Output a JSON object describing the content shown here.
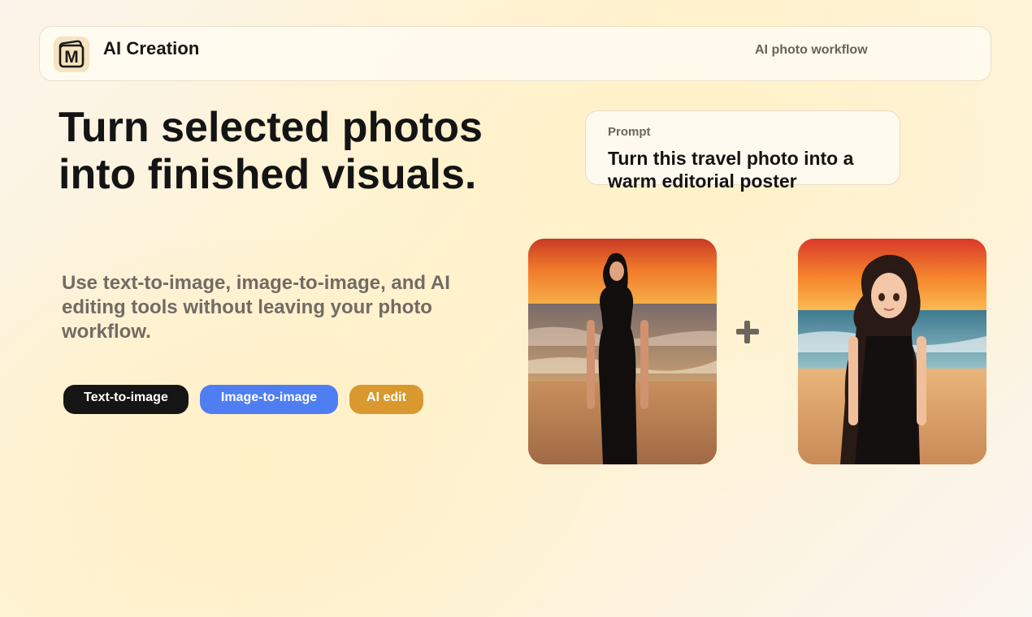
{
  "header": {
    "brand": "AI Creation",
    "logo_letter": "M",
    "tagline": "AI photo workflow"
  },
  "hero": {
    "title_line1": "Turn selected photos",
    "title_line2": "into finished visuals.",
    "description": "Use text-to-image, image-to-image, and AI editing tools without leaving your photo workflow."
  },
  "modes": [
    {
      "label": "Text-to-image",
      "color": "#151515"
    },
    {
      "label": "Image-to-image",
      "color": "#4f7ef2"
    },
    {
      "label": "AI edit",
      "color": "#d9992e"
    }
  ],
  "prompt": {
    "label": "Prompt",
    "text": "Turn this travel photo into a warm editorial poster"
  },
  "images": {
    "original": "sunset-beach-photo",
    "result": "anime-style-beach-illustration",
    "combine_icon": "plus-icon"
  },
  "colors": {
    "accent_blue": "#4f7ef2",
    "accent_gold": "#d9992e",
    "ink": "#141414",
    "muted": "#736b63"
  }
}
